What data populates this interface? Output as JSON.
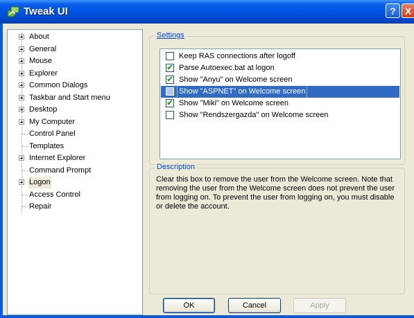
{
  "window": {
    "title": "Tweak UI",
    "help_button": "?",
    "close_button": "X",
    "accent": "#0054e3",
    "icon": "tweakui-app-icon"
  },
  "tree": {
    "items": [
      {
        "label": "About",
        "expandable": true,
        "selected": false
      },
      {
        "label": "General",
        "expandable": true,
        "selected": false
      },
      {
        "label": "Mouse",
        "expandable": true,
        "selected": false
      },
      {
        "label": "Explorer",
        "expandable": true,
        "selected": false
      },
      {
        "label": "Common Dialogs",
        "expandable": true,
        "selected": false
      },
      {
        "label": "Taskbar and Start menu",
        "expandable": true,
        "selected": false
      },
      {
        "label": "Desktop",
        "expandable": true,
        "selected": false
      },
      {
        "label": "My Computer",
        "expandable": true,
        "selected": false
      },
      {
        "label": "Control Panel",
        "expandable": false,
        "selected": false
      },
      {
        "label": "Templates",
        "expandable": false,
        "selected": false
      },
      {
        "label": "Internet Explorer",
        "expandable": true,
        "selected": false
      },
      {
        "label": "Command Prompt",
        "expandable": false,
        "selected": false
      },
      {
        "label": "Logon",
        "expandable": true,
        "selected": true
      },
      {
        "label": "Access Control",
        "expandable": false,
        "selected": false
      },
      {
        "label": "Repair",
        "expandable": false,
        "selected": false
      }
    ]
  },
  "settings": {
    "title": "Settings",
    "items": [
      {
        "label": "Keep RAS connections after logoff",
        "checked": false,
        "selected": false
      },
      {
        "label": "Parse Autoexec.bat at logon",
        "checked": true,
        "selected": false
      },
      {
        "label": "Show \"Anyu\" on Welcome screen",
        "checked": true,
        "selected": false
      },
      {
        "label": "Show \"ASPNET\" on Welcome screen",
        "checked": false,
        "selected": true
      },
      {
        "label": "Show \"Miki\" on Welcome screen",
        "checked": true,
        "selected": false
      },
      {
        "label": "Show \"Rendszergazda\" on Welcome screen",
        "checked": false,
        "selected": false
      }
    ]
  },
  "description": {
    "title": "Description",
    "text": "Clear this box to remove the user from the Welcome screen. Note that removing the user from the Welcome screen does not prevent the user from logging on.  To prevent the user from logging on, you must disable or delete the account."
  },
  "buttons": {
    "ok": "OK",
    "cancel": "Cancel",
    "apply": "Apply"
  }
}
